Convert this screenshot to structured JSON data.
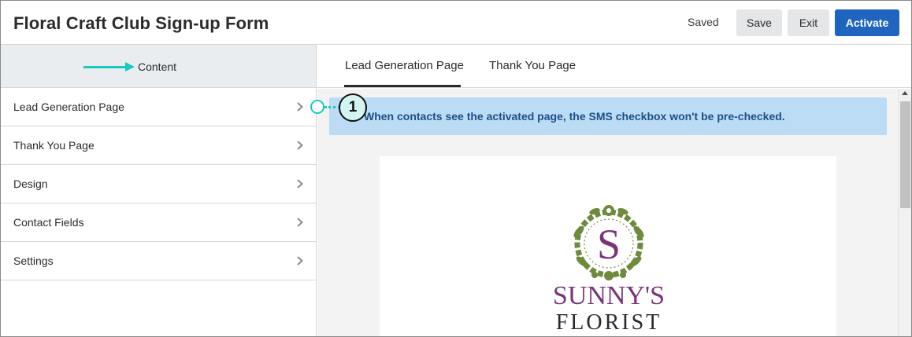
{
  "header": {
    "title": "Floral Craft Club Sign-up Form",
    "status": "Saved",
    "save_label": "Save",
    "exit_label": "Exit",
    "activate_label": "Activate"
  },
  "sidebar": {
    "heading": "Content",
    "items": [
      {
        "label": "Lead Generation Page",
        "icon": "chevron-right-icon"
      },
      {
        "label": "Thank You Page",
        "icon": "chevron-right-icon"
      },
      {
        "label": "Design",
        "icon": "chevron-right-icon"
      },
      {
        "label": "Contact Fields",
        "icon": "chevron-right-icon"
      },
      {
        "label": "Settings",
        "icon": "chevron-right-icon"
      }
    ]
  },
  "tabs": [
    {
      "label": "Lead Generation Page",
      "active": true
    },
    {
      "label": "Thank You Page",
      "active": false
    }
  ],
  "main": {
    "info_banner": "When contacts see the activated page, the SMS checkbox won't be pre-checked.",
    "logo": {
      "monogram": "S",
      "line1": "SUNNY'S",
      "line2": "FLORIST"
    }
  },
  "annotation": {
    "callout_number": "1"
  },
  "colors": {
    "primary_button": "#1f65c0",
    "secondary_button": "#e4e6e8",
    "info_banner_bg": "#bcdcf5",
    "info_banner_text": "#1c4f86",
    "annotation_accent": "#17c9c0",
    "logo_green": "#6e8a3c",
    "logo_purple": "#7a3578",
    "logo_dark": "#2a2a33"
  }
}
